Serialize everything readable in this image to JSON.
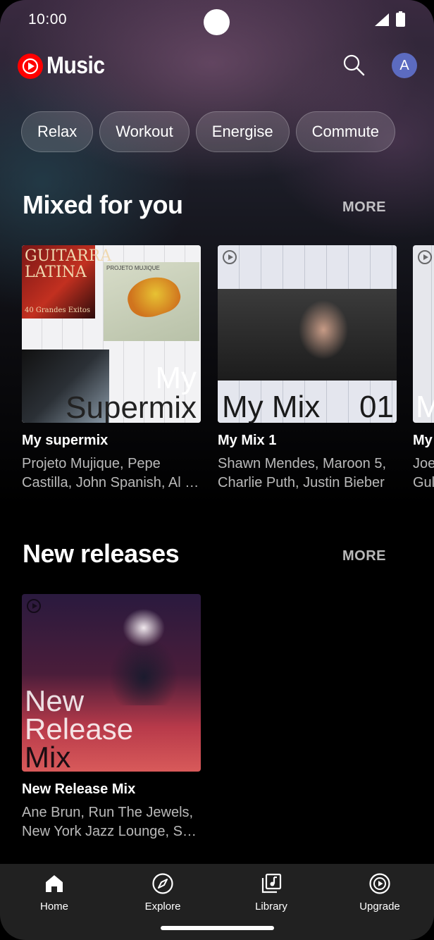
{
  "status_bar": {
    "time": "10:00"
  },
  "app_bar": {
    "logo_text": "Music",
    "avatar_letter": "A"
  },
  "chips": [
    "Relax",
    "Workout",
    "Energise",
    "Commute"
  ],
  "mixed_for_you": {
    "title": "Mixed for you",
    "more": "MORE",
    "cards": [
      {
        "title": "My supermix",
        "subtitle": "Projeto Mujique, Pepe Castilla, John Spanish, Al …",
        "art_line1": "My",
        "art_line2": "Supermix",
        "art_album1": "GUITARRA LATINA",
        "art_album1_sub": "40 Grandes Exitos",
        "art_album2": "PROJETO MUJIQUE"
      },
      {
        "title": "My Mix 1",
        "subtitle": "Shawn Mendes, Maroon 5, Charlie Puth, Justin Bieber",
        "art_left": "My Mix",
        "art_right": "01"
      },
      {
        "title": "My",
        "subtitle": "Joe Gul",
        "art_text": "M"
      }
    ]
  },
  "new_releases": {
    "title": "New releases",
    "more": "MORE",
    "cards": [
      {
        "title": "New Release Mix",
        "subtitle": "Ane Brun, Run The Jewels, New York Jazz Lounge, S…",
        "art_line1": "New",
        "art_line2": "Release",
        "art_line3": "Mix"
      }
    ]
  },
  "bottom_nav": [
    {
      "label": "Home",
      "icon": "home-icon"
    },
    {
      "label": "Explore",
      "icon": "compass-icon"
    },
    {
      "label": "Library",
      "icon": "library-icon"
    },
    {
      "label": "Upgrade",
      "icon": "upgrade-icon"
    }
  ],
  "colors": {
    "brand_red": "#ff0000",
    "avatar": "#5c6bc0",
    "nav_bg": "#212121"
  }
}
